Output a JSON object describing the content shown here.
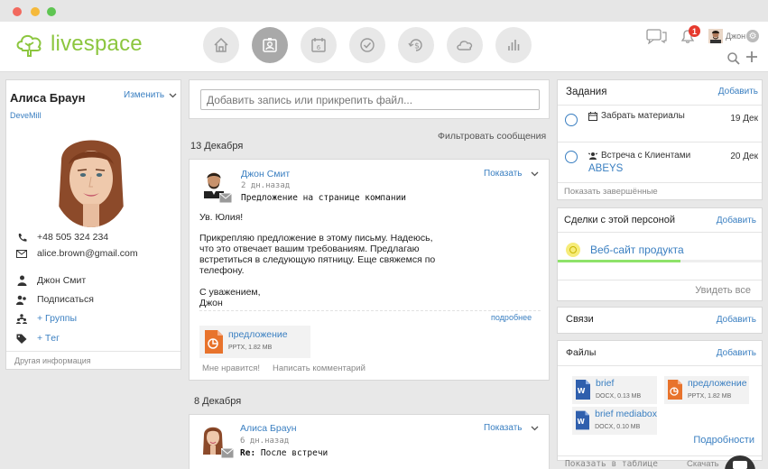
{
  "header": {
    "logo_text": "livespace",
    "notifications_count": "1",
    "user_name": "Джон"
  },
  "profile": {
    "name": "Алиса Браун",
    "edit_label": "Изменить",
    "company": "DeveMill",
    "phone": "+48 505 324 234",
    "email": "alice.brown@gmail.com",
    "owner": "Джон Смит",
    "subscribe": "Подписаться",
    "groups": "+ Группы",
    "tag": "+ Tег",
    "other_info": "Другая информация"
  },
  "feed": {
    "input_placeholder": "Добавить запись или прикрепить файл...",
    "filter_label": "Фильтровать сообщения",
    "date1": "13 Декабря",
    "post1": {
      "author": "Джон Смит",
      "time": "2 дн.назад",
      "subject": "Предложение на странице компании",
      "show_label": "Показать",
      "greeting": "Ув. Юлия!",
      "body": "Прикрепляю предложение в этому письму. Надеюсь, что это отвечает вашим требованиям. Предлагаю встретиться в следующую пятницу. Еще свяжемся по телефону.",
      "sign1": "С уважением,",
      "sign2": "Джон",
      "more": "подробнее",
      "file_name": "предложение",
      "file_meta": "PPTX, 1.82 MB",
      "like": "Мне нравится!",
      "comment": "Написать комментарий"
    },
    "date2": "8 Декабря",
    "post2": {
      "author": "Алиса Браун",
      "time": "6 дн.назад",
      "subject_prefix": "Re:",
      "subject": "После встречи",
      "show_label": "Показать"
    }
  },
  "tasks": {
    "title": "Задания",
    "add": "Добавить",
    "items": [
      {
        "label": "Забрать материалы",
        "date": "19 Дек"
      },
      {
        "label": "Встреча с Клиентами",
        "sub": "ABEYS",
        "date": "20 Дек"
      }
    ],
    "show_done": "Показать завершённые"
  },
  "deals": {
    "title": "Сделки с этой персоной",
    "add": "Добавить",
    "item": "Веб-сайт продукта",
    "progress": 0.6,
    "see_all": "Увидеть все"
  },
  "links": {
    "title": "Связи",
    "add": "Добавить"
  },
  "files": {
    "title": "Файлы",
    "add": "Добавить",
    "items": [
      {
        "name": "brief",
        "meta": "DOCX, 0.13 MB"
      },
      {
        "name": "предложение",
        "meta": "PPTX, 1.82 MB"
      },
      {
        "name": "brief mediabox",
        "meta": "DOCX, 0.10 MB"
      }
    ],
    "more": "Подробности",
    "show_table": "Показать в таблице",
    "download": "Скачать"
  }
}
